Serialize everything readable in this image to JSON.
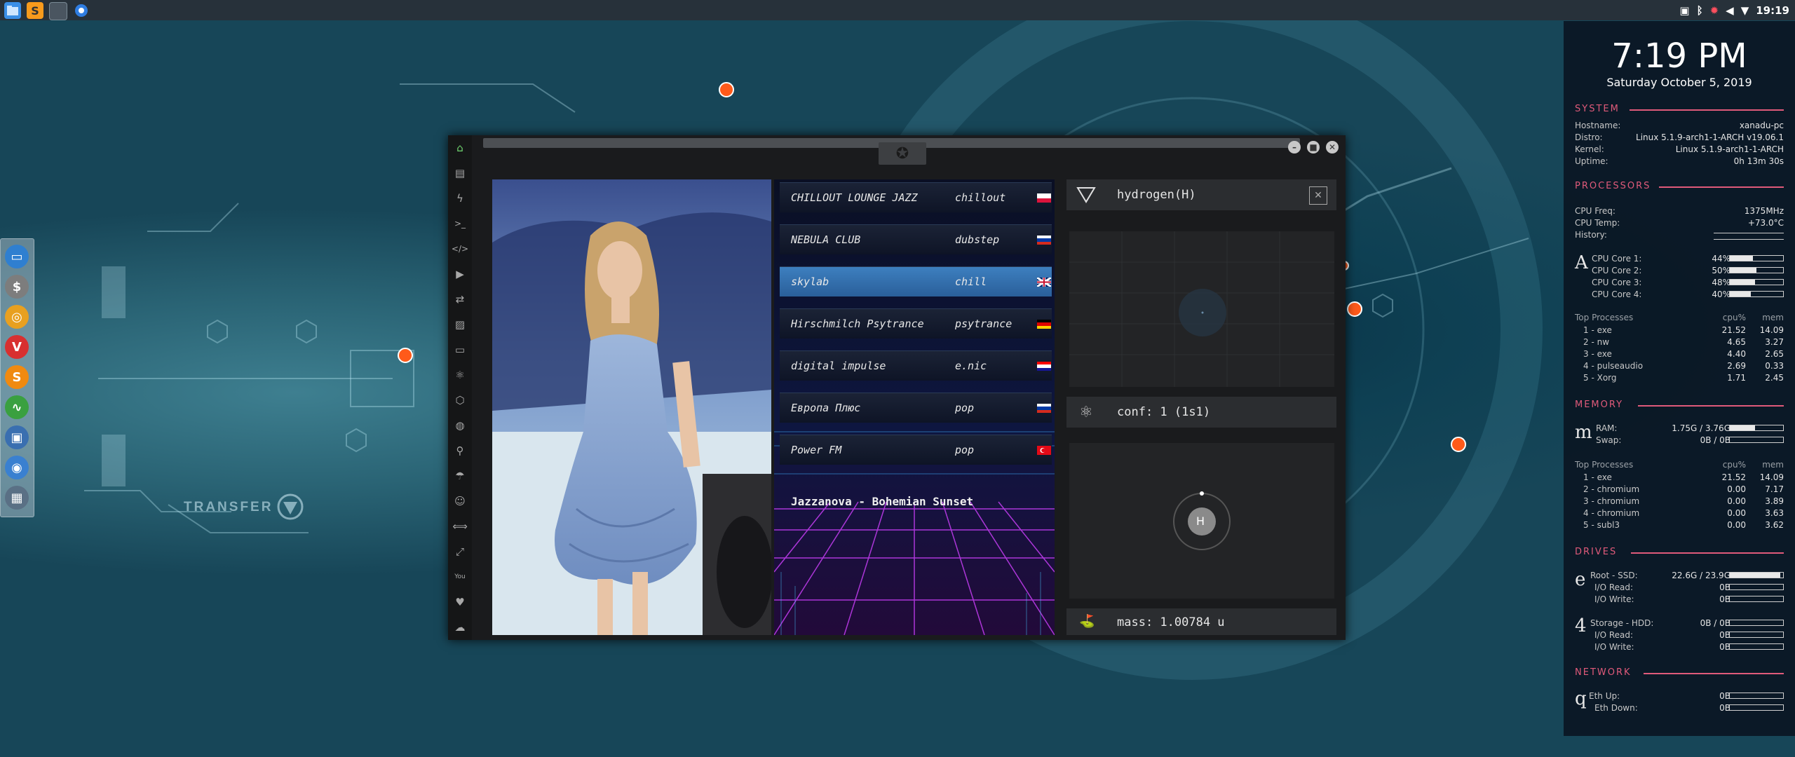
{
  "taskbar": {
    "apps": [
      {
        "icon": "file-manager-icon",
        "color": "#3a8ee6"
      },
      {
        "icon": "sublime-text-icon",
        "color": "#f89a1c"
      },
      {
        "icon": "terminal-icon",
        "color": "#4a5560"
      },
      {
        "icon": "chromium-icon",
        "color": "#2f7de1"
      }
    ],
    "tray_icons": [
      "screenshot-icon",
      "bluetooth-icon",
      "update-icon",
      "volume-icon",
      "wifi-icon"
    ],
    "clock": "19:19"
  },
  "desktop": {
    "transfer_label": "TRANSFER"
  },
  "dock": {
    "items": [
      {
        "icon": "file-manager-icon",
        "color": "#2f7fd0"
      },
      {
        "icon": "money-icon",
        "color": "#7d7d7d"
      },
      {
        "icon": "ubuntu-icon",
        "color": "#e8a020"
      },
      {
        "icon": "vivaldi-icon",
        "color": "#d83030"
      },
      {
        "icon": "sublime-text-icon",
        "color": "#f08a10"
      },
      {
        "icon": "activity-monitor-icon",
        "color": "#3aa040"
      },
      {
        "icon": "screen-icon",
        "color": "#3a6fb0"
      },
      {
        "icon": "chromium-icon",
        "color": "#3a80d0"
      },
      {
        "icon": "grid-icon",
        "color": "#5a7085"
      }
    ]
  },
  "player": {
    "sidebar_icons": [
      "home-icon",
      "document-icon",
      "lightning-icon",
      "terminal-icon",
      "code-icon",
      "play-icon",
      "file-transfer-icon",
      "image-icon",
      "id-card-icon",
      "atom-icon",
      "hexagon-icon",
      "globe-icon",
      "search-icon",
      "umbrella-icon",
      "contact-icon",
      "exchange-icon",
      "expand-icon",
      "youtube-icon",
      "heart-icon",
      "cloud-icon"
    ],
    "stations": [
      {
        "name": "CHILLOUT LOUNGE JAZZ",
        "genre": "chillout",
        "flag": "poland"
      },
      {
        "name": "NEBULA CLUB",
        "genre": "dubstep",
        "flag": "russia"
      },
      {
        "name": "skylab",
        "genre": "chill",
        "flag": "uk"
      },
      {
        "name": "Hirschmilch Psytrance",
        "genre": "psytrance",
        "flag": "germany"
      },
      {
        "name": "digital impulse",
        "genre": "e.nic",
        "flag": "croatia"
      },
      {
        "name": "Европа Плюс",
        "genre": "pop",
        "flag": "russia"
      },
      {
        "name": "Power FM",
        "genre": "pop",
        "flag": "turkey"
      }
    ],
    "now_playing": "Jazzanova - Bohemian Sunset",
    "element": {
      "name": "hydrogen(H)",
      "config": "conf: 1 (1s1)",
      "symbol": "H",
      "mass": "mass: 1.00784 u"
    }
  },
  "conky": {
    "time": "7:19 PM",
    "date": "Saturday October  5, 2019",
    "system": {
      "title": "SYSTEM",
      "rows": [
        {
          "label": "Hostname:",
          "value": "xanadu-pc"
        },
        {
          "label": "Distro:",
          "value": "Linux 5.1.9-arch1-1-ARCH v19.06.1"
        },
        {
          "label": "Kernel:",
          "value": "Linux 5.1.9-arch1-1-ARCH"
        },
        {
          "label": "Uptime:",
          "value": "0h 13m 30s"
        }
      ]
    },
    "processors": {
      "title": "PROCESSORS",
      "freq_label": "CPU Freq:",
      "freq": "1375MHz",
      "temp_label": "CPU Temp:",
      "temp": "+73.0°C",
      "history_label": "History:",
      "glyph": "A",
      "cores": [
        {
          "label": "CPU Core 1:",
          "value": "44%",
          "fraction": 0.44
        },
        {
          "label": "CPU Core 2:",
          "value": "50%",
          "fraction": 0.5
        },
        {
          "label": "CPU Core 3:",
          "value": "48%",
          "fraction": 0.48
        },
        {
          "label": "CPU Core 4:",
          "value": "40%",
          "fraction": 0.4
        }
      ],
      "top_title": "Top Processes",
      "col_cpu": "cpu%",
      "col_mem": "mem",
      "top": [
        {
          "name": "1 - exe",
          "cpu": "21.52",
          "mem": "14.09"
        },
        {
          "name": "2 - nw",
          "cpu": "4.65",
          "mem": "3.27"
        },
        {
          "name": "3 - exe",
          "cpu": "4.40",
          "mem": "2.65"
        },
        {
          "name": "4 - pulseaudio",
          "cpu": "2.69",
          "mem": "0.33"
        },
        {
          "name": "5 - Xorg",
          "cpu": "1.71",
          "mem": "2.45"
        }
      ]
    },
    "memory": {
      "title": "MEMORY",
      "glyph": "m",
      "ram_label": "RAM:",
      "ram": "1.75G / 3.76G",
      "ram_fraction": 0.47,
      "swap_label": "Swap:",
      "swap": "0B / 0B",
      "swap_fraction": 0,
      "top_title": "Top Processes",
      "col_cpu": "cpu%",
      "col_mem": "mem",
      "top": [
        {
          "name": "1 - exe",
          "cpu": "21.52",
          "mem": "14.09"
        },
        {
          "name": "2 - chromium",
          "cpu": "0.00",
          "mem": "7.17"
        },
        {
          "name": "3 - chromium",
          "cpu": "0.00",
          "mem": "3.89"
        },
        {
          "name": "4 - chromium",
          "cpu": "0.00",
          "mem": "3.63"
        },
        {
          "name": "5 - subl3",
          "cpu": "0.00",
          "mem": "3.62"
        }
      ]
    },
    "drives": {
      "title": "DRIVES",
      "root": {
        "glyph": "e",
        "label": "Root  - SSD:",
        "value": "22.6G / 23.9G",
        "fraction": 0.95,
        "read_label": "I/O Read:",
        "read": "0B",
        "write_label": "I/O Write:",
        "write": "0B"
      },
      "storage": {
        "glyph": "4",
        "label": "Storage  - HDD:",
        "value": "0B / 0B",
        "fraction": 0,
        "read_label": "I/O Read:",
        "read": "0B",
        "write_label": "I/O Write:",
        "write": "0B"
      }
    },
    "network": {
      "title": "NETWORK",
      "glyph": "q",
      "up_label": "Eth Up:",
      "up": "0B",
      "down_label": "Eth Down:",
      "down": "0B"
    }
  }
}
